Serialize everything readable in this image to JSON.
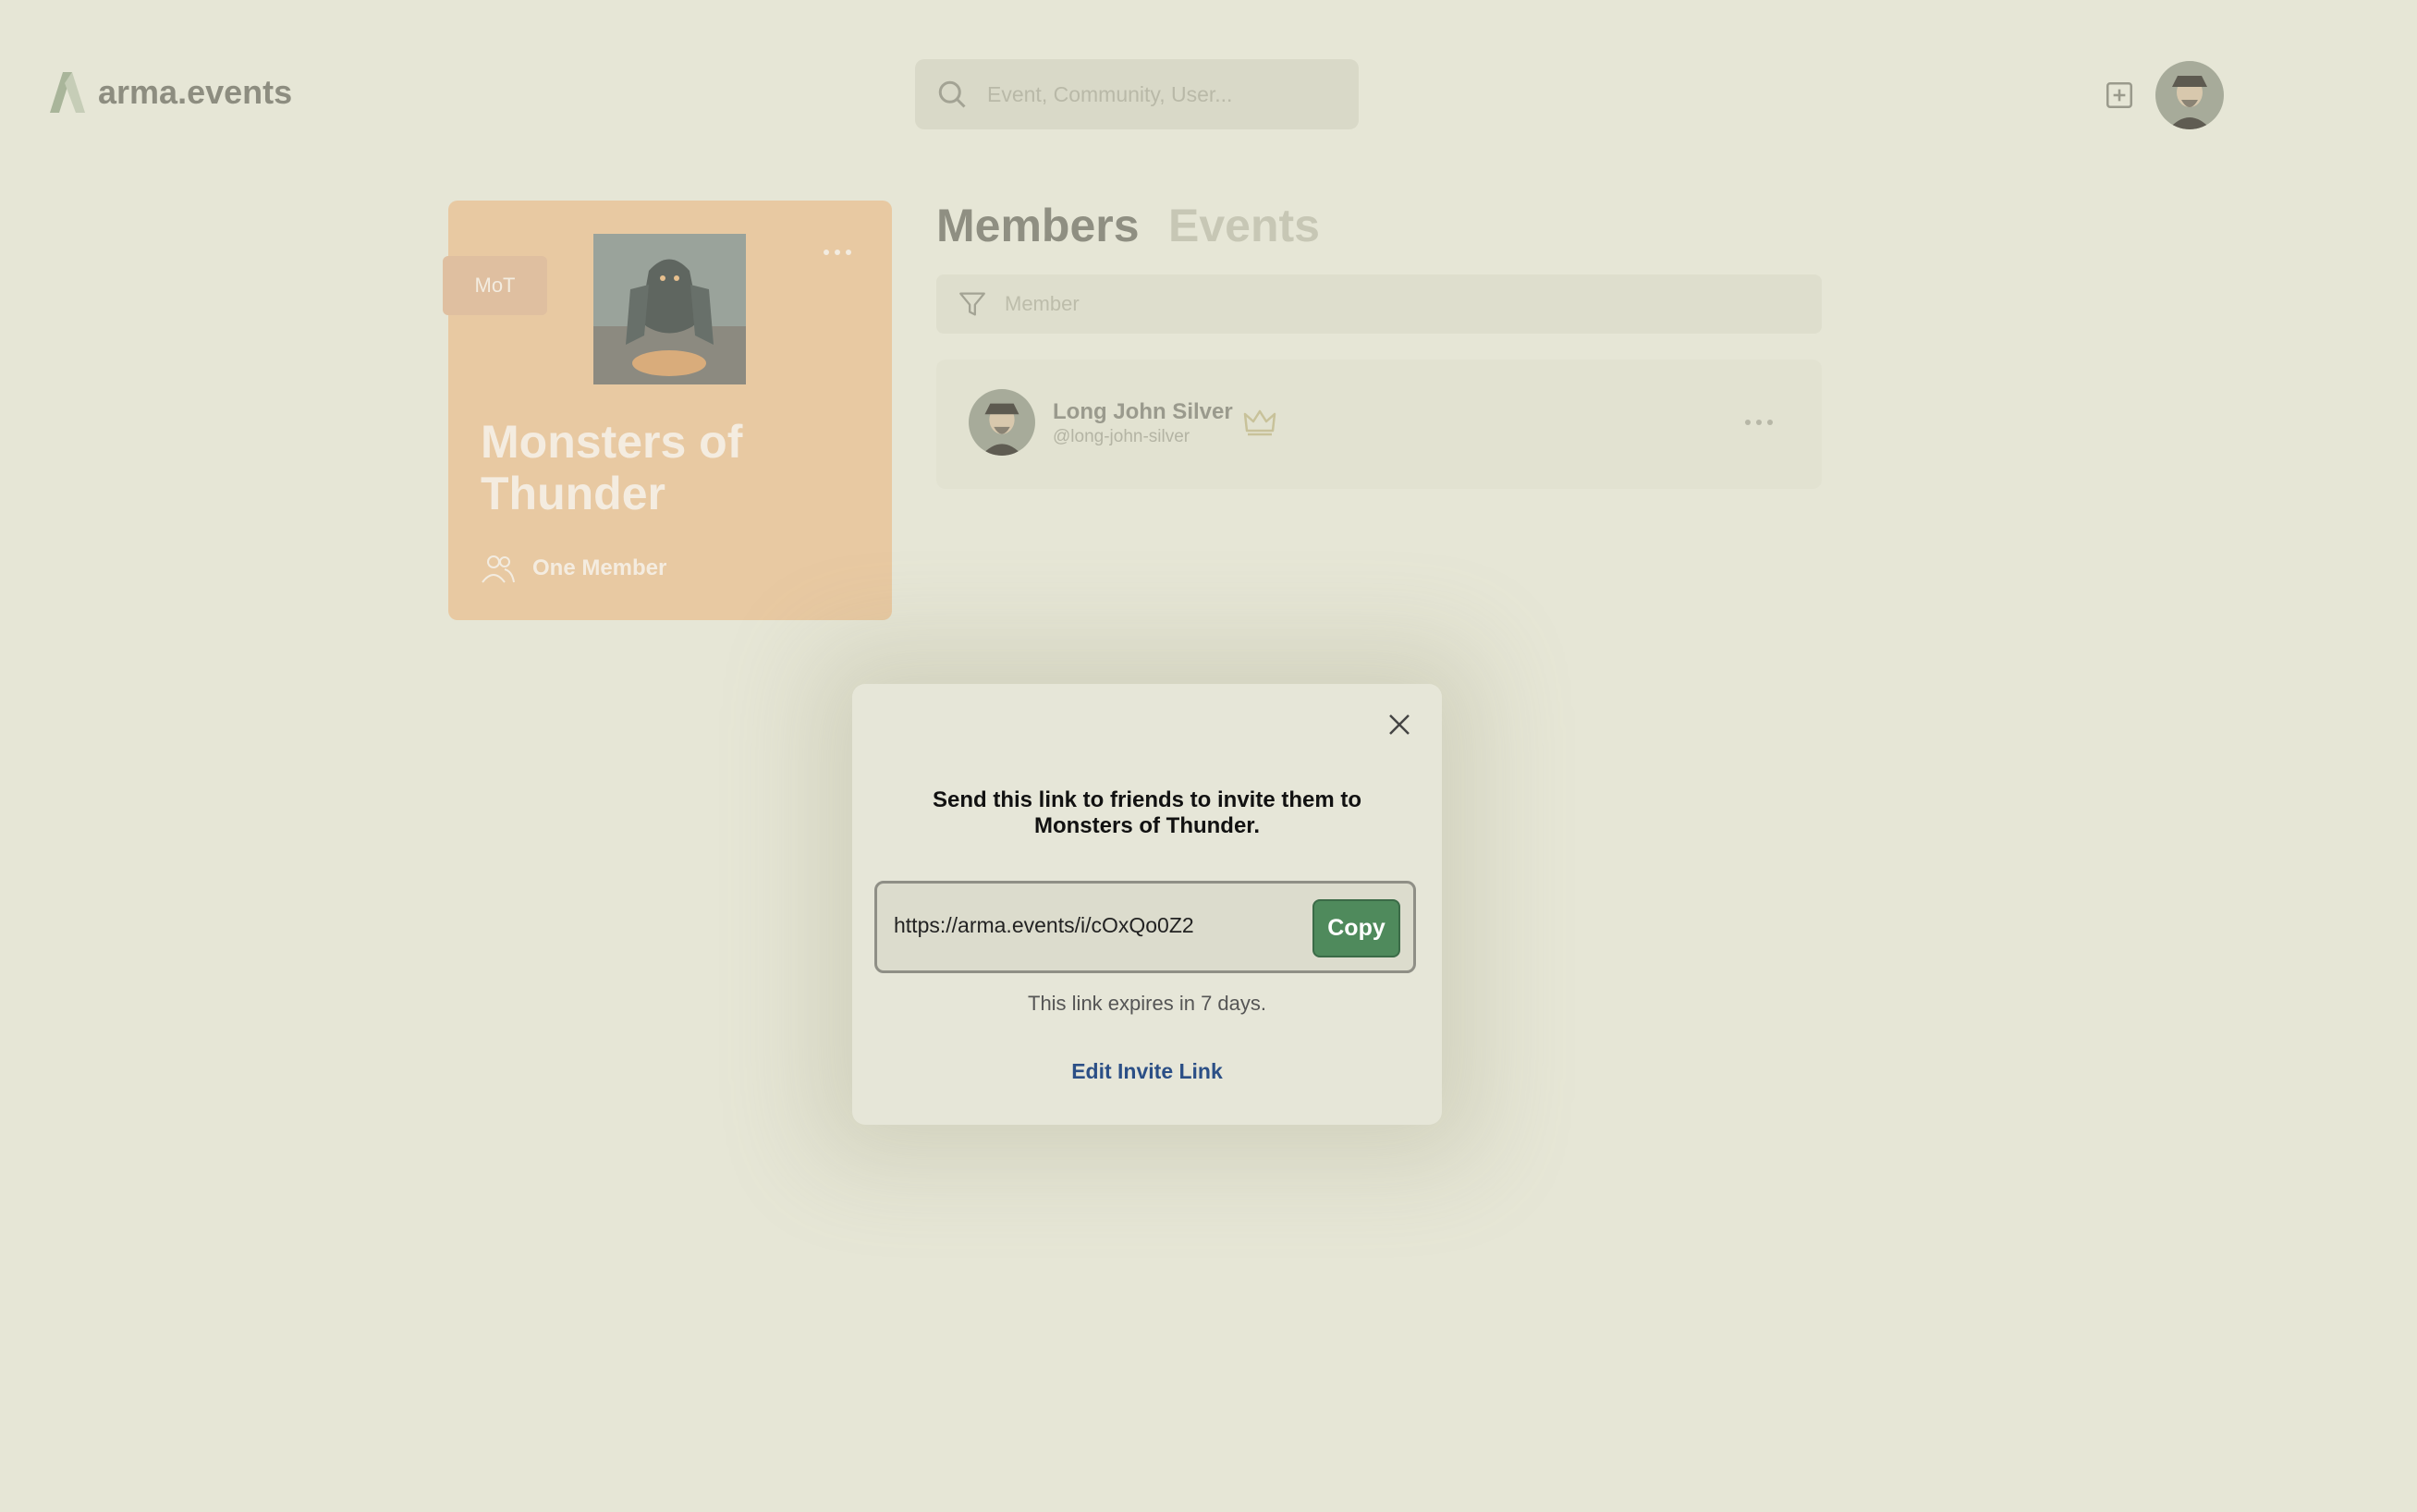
{
  "app": {
    "logo_text": "arma.events",
    "search_placeholder": "Event, Community, User..."
  },
  "community": {
    "abbreviation": "MoT",
    "name": "Monsters of Thunder",
    "member_count_label": "One Member"
  },
  "tabs": [
    {
      "label": "Members",
      "active": true
    },
    {
      "label": "Events",
      "active": false
    }
  ],
  "members": {
    "filter_placeholder": "Member",
    "list": [
      {
        "name": "Long John Silver",
        "handle": "@long-john-silver",
        "role_icon": "crown-icon"
      }
    ]
  },
  "invite_modal": {
    "title": "Send this link to friends to invite them to Monsters of Thunder.",
    "link": "https://arma.events/i/cOxQo0Z2",
    "copy_label": "Copy",
    "expiry_text": "This link expires in 7 days.",
    "edit_label": "Edit Invite Link"
  },
  "colors": {
    "background": "#e6e6d6",
    "card": "#e8c9a2",
    "copy_button": "#4f8a5c",
    "edit_link": "#2b4f86"
  }
}
